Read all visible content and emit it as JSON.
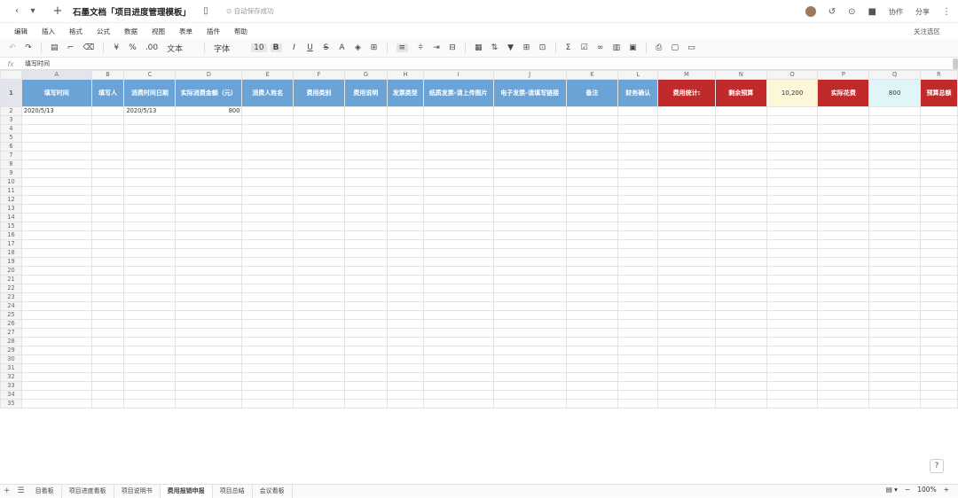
{
  "titlebar": {
    "back_icon": "chevron-left-icon",
    "forward_icon": "chevron-down-icon",
    "add_icon": "plus-icon",
    "doc_title": "石墨文档「项目进度管理模板」",
    "status": "⊙ 自动保存成功",
    "collab": "协作",
    "share": "分享"
  },
  "menu": [
    "编辑",
    "插入",
    "格式",
    "公式",
    "数据",
    "视图",
    "表单",
    "插件",
    "帮助"
  ],
  "focus_select": "关注选区",
  "toolbar": {
    "currency": "¥",
    "percent": "%",
    "decimal": ".00",
    "text_format": "文本",
    "font": "字体",
    "font_size": "10"
  },
  "formula": {
    "label": "fx",
    "value": "填写时间"
  },
  "columns": [
    "A",
    "B",
    "C",
    "D",
    "E",
    "F",
    "G",
    "H",
    "I",
    "J",
    "K",
    "L",
    "M",
    "N",
    "O",
    "P",
    "Q",
    "R"
  ],
  "header_row": {
    "A": "填写时间",
    "B": "填写人",
    "C": "消费时间日期",
    "D": "实际消费金额（元）",
    "E": "消费人姓名",
    "F": "费用类别",
    "G": "费用说明",
    "H": "发票类型",
    "I": "纸质发票-请上传图片",
    "J": "电子发票-请填写链接",
    "K": "备注",
    "L": "财务确认",
    "M": "费用统计:",
    "N": "剩余预算",
    "O": "10,200",
    "P": "实际花费",
    "Q": "800",
    "R": "预算总额"
  },
  "row2": {
    "A": "2020/5/13",
    "C": "2020/5/13",
    "D": "800"
  },
  "row_numbers": [
    "1",
    "2",
    "3",
    "4",
    "5",
    "6",
    "7",
    "8",
    "9",
    "10",
    "11",
    "12",
    "13",
    "14",
    "15",
    "16",
    "17",
    "18",
    "19",
    "20",
    "21",
    "22",
    "23",
    "24",
    "25",
    "26",
    "27",
    "28",
    "29",
    "30",
    "31",
    "32",
    "33",
    "34",
    "35"
  ],
  "tabs": [
    "目看板",
    "项目进度看板",
    "项目说明书",
    "费用报销申报",
    "项目总结",
    "会议看板"
  ],
  "active_tab": "费用报销申报",
  "zoom": "100%",
  "colors": {
    "header_blue": "#6ba3d6",
    "stat_red": "#c02a2a",
    "value_yellow": "#fdf7d8",
    "value_cyan": "#e0f5f7"
  }
}
